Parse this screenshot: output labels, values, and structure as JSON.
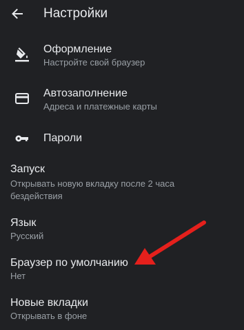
{
  "header": {
    "back_icon": "arrow-back-icon",
    "title": "Настройки"
  },
  "items": [
    {
      "icon": "paint-bucket-icon",
      "title": "Оформление",
      "subtitle": "Настройте свой браузер"
    },
    {
      "icon": "credit-card-icon",
      "title": "Автозаполнение",
      "subtitle": "Адреса и платежные карты"
    },
    {
      "icon": "key-icon",
      "title": "Пароли"
    },
    {
      "title": "Запуск",
      "subtitle_line1": "Открывать новую вкладку после 2 часа",
      "subtitle_line2": "бездействия"
    },
    {
      "title": "Язык",
      "subtitle": "Русский"
    },
    {
      "title": "Браузер по умолчанию",
      "subtitle": "Нет"
    },
    {
      "title": "Новые вкладки",
      "subtitle": "Открывать в фоне"
    }
  ],
  "colors": {
    "background": "#202124",
    "text_primary": "#e8eaed",
    "text_secondary": "#9aa0a6",
    "annotation_arrow": "#e5201c"
  }
}
